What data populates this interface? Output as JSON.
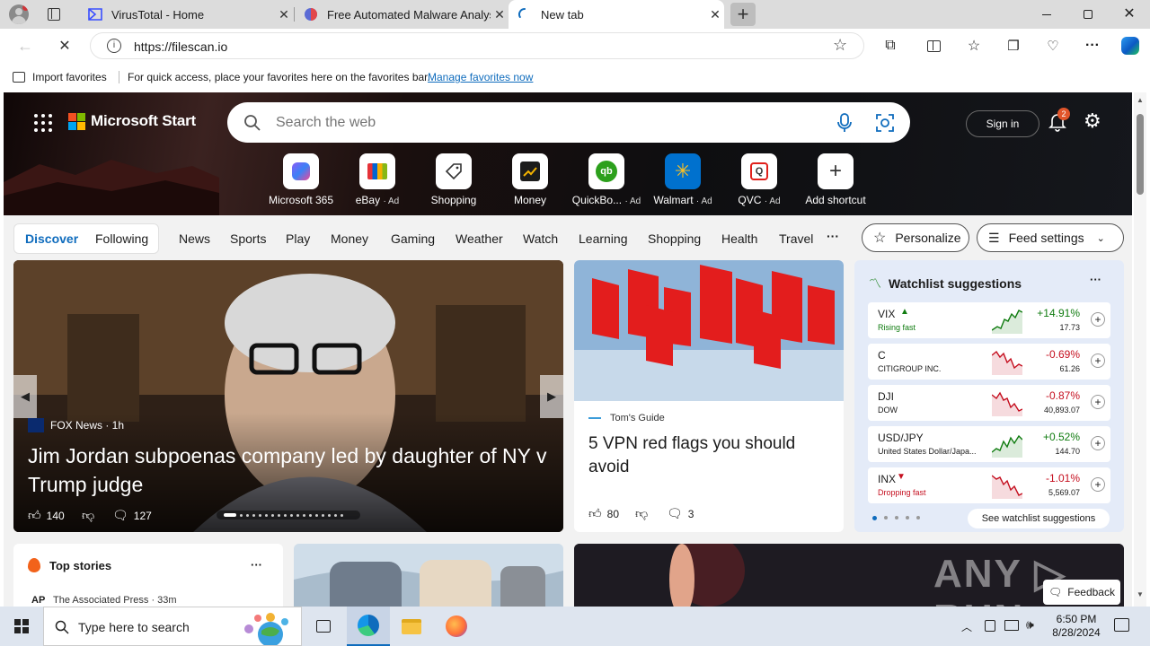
{
  "tabs": [
    {
      "title": "VirusTotal - Home",
      "icon": "virustotal-icon"
    },
    {
      "title": "Free Automated Malware Analysis",
      "icon": "filescan-icon"
    },
    {
      "title": "New tab",
      "icon": "loading-icon"
    }
  ],
  "address": {
    "url": "https://filescan.io"
  },
  "favorites_bar": {
    "import": "Import favorites",
    "hint": "For quick access, place your favorites here on the favorites bar.",
    "manage": "Manage favorites now"
  },
  "start": {
    "brand": "Microsoft Start",
    "search_placeholder": "Search the web",
    "sign_in": "Sign in",
    "notification_count": "2",
    "shortcuts": [
      {
        "label": "Microsoft 365",
        "ad": ""
      },
      {
        "label": "eBay",
        "ad": "· Ad"
      },
      {
        "label": "Shopping",
        "ad": ""
      },
      {
        "label": "Money",
        "ad": ""
      },
      {
        "label": "QuickBo...",
        "ad": "· Ad"
      },
      {
        "label": "Walmart",
        "ad": "· Ad"
      },
      {
        "label": "QVC",
        "ad": "· Ad"
      },
      {
        "label": "Add shortcut",
        "ad": ""
      }
    ]
  },
  "nav": {
    "discover": "Discover",
    "following": "Following",
    "items": [
      "News",
      "Sports",
      "Play",
      "Money",
      "Gaming",
      "Weather",
      "Watch",
      "Learning",
      "Shopping",
      "Health",
      "Travel"
    ],
    "more": "···",
    "personalize": "Personalize",
    "feed_settings": "Feed settings"
  },
  "hero_story": {
    "source": "FOX News · 1h",
    "headline": "Jim Jordan subpoenas company led by daughter of NY v Trump judge",
    "likes": "140",
    "comments": "127"
  },
  "vpn_story": {
    "source": "Tom's Guide",
    "headline": "5 VPN red flags you should avoid",
    "likes": "80",
    "comments": "3"
  },
  "watchlist": {
    "title": "Watchlist suggestions",
    "more": "···",
    "see_all": "See watchlist suggestions",
    "rows": [
      {
        "symbol": "VIX",
        "sub": "Rising fast",
        "change": "+14.91%",
        "price": "17.73",
        "trend": "up"
      },
      {
        "symbol": "C",
        "sub": "CITIGROUP INC.",
        "change": "-0.69%",
        "price": "61.26",
        "trend": "down"
      },
      {
        "symbol": "DJI",
        "sub": "DOW",
        "change": "-0.87%",
        "price": "40,893.07",
        "trend": "down"
      },
      {
        "symbol": "USD/JPY",
        "sub": "United States Dollar/Japa...",
        "change": "+0.52%",
        "price": "144.70",
        "trend": "up"
      },
      {
        "symbol": "INX",
        "sub": "Dropping fast",
        "change": "-1.01%",
        "price": "5,569.07",
        "trend": "down"
      }
    ]
  },
  "top_stories": {
    "title": "Top stories",
    "more": "···",
    "first_source": "The Associated Press · 33m"
  },
  "feedback": "Feedback",
  "taskbar": {
    "search_placeholder": "Type here to search",
    "time": "6:50 PM",
    "date": "8/28/2024"
  },
  "colors": {
    "accent": "#0f6cbd",
    "up": "#107c10",
    "down": "#c50f1f"
  }
}
